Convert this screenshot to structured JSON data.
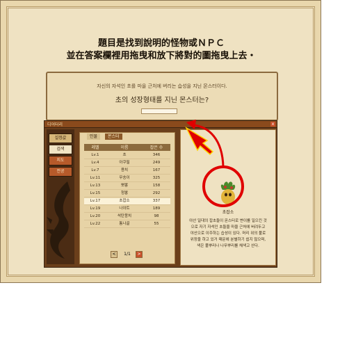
{
  "instructions": {
    "line1": "題目是找到說明的怪物或ＮＰＣ",
    "line2": "並在答案欄裡用拖曳和放下將對的圖拖曳上去・"
  },
  "question": {
    "sub": "자신의 자석인 초를 마을 근처에 버리는 습성을 지닌 몬스터이다.",
    "main": "초의 성장형태를 지닌 몬스터는?"
  },
  "dictionary": {
    "title": "디어터리",
    "close": "x",
    "side_buttons": [
      "설정값",
      "검색",
      "지도",
      "전공"
    ],
    "tabs": [
      "인물",
      "몬스터"
    ],
    "columns": [
      "레벨",
      "이름",
      "잡은 수"
    ],
    "rows": [
      {
        "level": "Lv.1",
        "name": "초",
        "count": "346"
      },
      {
        "level": "Lv.4",
        "name": "아쿠필",
        "count": "249"
      },
      {
        "level": "Lv.7",
        "name": "용치",
        "count": "167"
      },
      {
        "level": "Lv.11",
        "name": "무송이",
        "count": "325"
      },
      {
        "level": "Lv.13",
        "name": "뽀뽕",
        "count": "158"
      },
      {
        "level": "Lv.15",
        "name": "청뽕",
        "count": "292"
      },
      {
        "level": "Lv.17",
        "name": "초잡소",
        "count": "337"
      },
      {
        "level": "Lv.19",
        "name": "나이트",
        "count": "189"
      },
      {
        "level": "Lv.20",
        "name": "석탄뭉치",
        "count": "98"
      },
      {
        "level": "Lv.22",
        "name": "통나골",
        "count": "55"
      }
    ],
    "pager": {
      "prev": "<",
      "page": "1/1",
      "next": ">"
    },
    "detail": {
      "name": "초잡소",
      "description": "야산 일대의 잡초들이 몬스터로 변이를 일으킨 것으로 자기 자석인 초들을 마을 근처에 버려두고 야산으로 이주하는 습성이 있다. 머리 위의 풀로 위장을 하고 있거 때문에 분별하기 쉽지 않으며, 색은 풀뿌리나 나무뿌리를 채색고 산다."
    }
  },
  "colors": {
    "accent_red": "#e00000",
    "frame": "#e9d7ad",
    "dark_wood": "#6b3f1b"
  }
}
